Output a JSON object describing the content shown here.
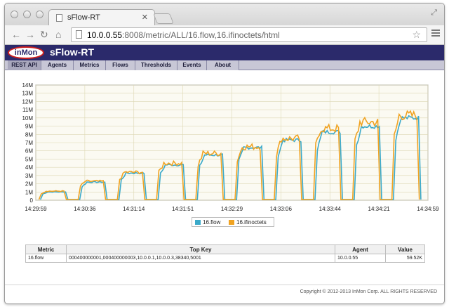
{
  "browser": {
    "tab_title": "sFlow-RT",
    "url_host": "10.0.0.55",
    "url_rest": ":8008/metric/ALL/16.flow,16.ifinoctets/html"
  },
  "app": {
    "logo_text": "inMon",
    "brand": "sFlow-RT",
    "menu": [
      "REST API",
      "Agents",
      "Metrics",
      "Flows",
      "Thresholds",
      "Events",
      "About"
    ]
  },
  "chart_data": {
    "type": "line",
    "ylim": [
      0,
      14000000
    ],
    "y_ticks": [
      "0",
      "1M",
      "2M",
      "3M",
      "4M",
      "5M",
      "6M",
      "7M",
      "8M",
      "9M",
      "10M",
      "11M",
      "12M",
      "13M",
      "14M"
    ],
    "x_ticks": [
      "14:29:59",
      "14:30:36",
      "14:31:14",
      "14:31:51",
      "14:32:29",
      "14:33:06",
      "14:33:44",
      "14:34:21",
      "14:34:59"
    ],
    "grid": true,
    "legend_position": "bottom",
    "series": [
      {
        "name": "16.flow",
        "color": "#3aa9c9",
        "levels": [
          1000000,
          2200000,
          3300000,
          4300000,
          5500000,
          6400000,
          7300000,
          8300000,
          9000000,
          10000000
        ]
      },
      {
        "name": "16.ifinoctets",
        "color": "#f0a322",
        "levels": [
          1100000,
          2300000,
          3400000,
          4500000,
          5700000,
          6500000,
          7500000,
          8700000,
          9500000,
          10300000
        ]
      }
    ]
  },
  "table": {
    "headers": [
      "Metric",
      "Top Key",
      "Agent",
      "Value"
    ],
    "rows": [
      [
        "16.flow",
        "000400000001,000400000003,10.0.0.1,10.0.0.3,38340,5001",
        "10.0.0.55",
        "59.52K"
      ]
    ]
  },
  "footer": "Copyright © 2012-2013 InMon Corp. ALL RIGHTS RESERVED",
  "colors": {
    "brand_bar": "#2b2a6b",
    "menu_bar": "#c8c7d6"
  }
}
